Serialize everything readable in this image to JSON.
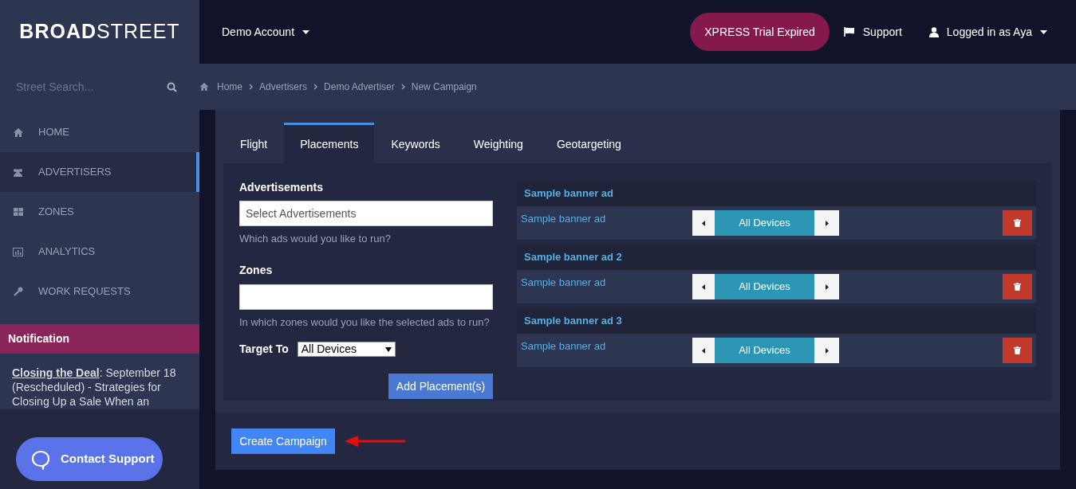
{
  "logo": "**BROAD**STREET",
  "account_menu": "Demo Account",
  "trial_badge": "XPRESS Trial Expired",
  "support_link": "Support",
  "user_menu": "Logged in as Aya",
  "search": {
    "placeholder": "Street Search..."
  },
  "breadcrumbs": [
    "Home",
    "Advertisers",
    "Demo Advertiser",
    "New Campaign"
  ],
  "nav": [
    {
      "label": "HOME",
      "selected": false
    },
    {
      "label": "ADVERTISERS",
      "selected": true
    },
    {
      "label": "ZONES",
      "selected": false
    },
    {
      "label": "ANALYTICS",
      "selected": false
    },
    {
      "label": "WORK REQUESTS",
      "selected": false
    }
  ],
  "notification": {
    "title": "Notification",
    "link": "Closing the Deal",
    "text": ": September 18 (Rescheduled) - Strategies for Closing Up a Sale When an"
  },
  "contact_support": "Contact Support",
  "tabs": [
    {
      "label": "Flight",
      "selected": false
    },
    {
      "label": "Placements",
      "selected": true
    },
    {
      "label": "Keywords",
      "selected": false
    },
    {
      "label": "Weighting",
      "selected": false
    },
    {
      "label": "Geotargeting",
      "selected": false
    }
  ],
  "form": {
    "advertisements_label": "Advertisements",
    "advertisements_placeholder": "Select Advertisements",
    "advertisements_help": "Which ads would you like to run?",
    "zones_label": "Zones",
    "zones_help": "In which zones would you like the selected ads to run?",
    "target_label": "Target To",
    "target_value": "All Devices",
    "add_button": "Add Placement(s)"
  },
  "placements": [
    {
      "title": "Sample banner ad",
      "ad": "Sample banner ad",
      "device": "All Devices"
    },
    {
      "title": "Sample banner ad 2",
      "ad": "Sample banner ad",
      "device": "All Devices"
    },
    {
      "title": "Sample banner ad 3",
      "ad": "Sample banner ad",
      "device": "All Devices"
    }
  ],
  "create_button": "Create Campaign"
}
